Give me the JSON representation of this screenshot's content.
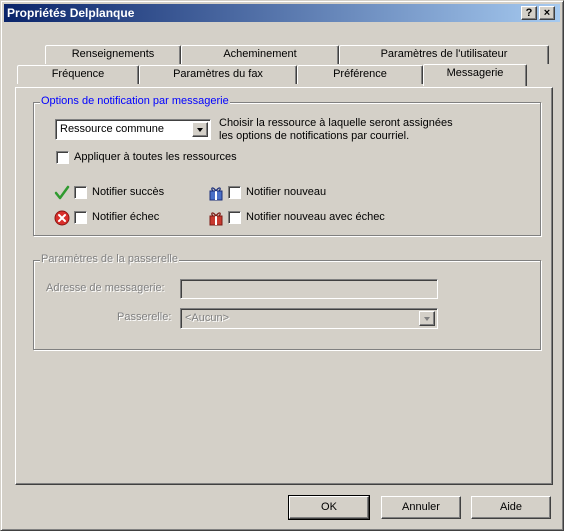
{
  "window": {
    "title": "Propriétés Delplanque",
    "help_btn": "?",
    "close_btn": "×"
  },
  "tabs_row1": [
    "Renseignements",
    "Acheminement",
    "Paramètres de l'utilisateur"
  ],
  "tabs_row2": [
    "Fréquence",
    "Paramètres du fax",
    "Préférence",
    "Messagerie"
  ],
  "active_tab": "Messagerie",
  "notifications": {
    "group_label": "Options de notification par messagerie",
    "resource_select": "Ressource commune",
    "resource_help_line1": "Choisir la ressource à laquelle seront assignées",
    "resource_help_line2": "les options de notifications par courriel.",
    "apply_all_label": "Appliquer à toutes les ressources",
    "apply_all_checked": false,
    "success_label": "Notifier succès",
    "new_label": "Notifier nouveau",
    "failure_label": "Notifier échec",
    "new_failure_label": "Notifier nouveau avec échec"
  },
  "gateway": {
    "group_label": "Paramètres de la passerelle",
    "address_label": "Adresse de messagerie:",
    "address_value": "",
    "gateway_label": "Passerelle:",
    "gateway_value": "<Aucun>"
  },
  "buttons": {
    "ok": "OK",
    "cancel": "Annuler",
    "help": "Aide"
  },
  "colors": {
    "accent": "#0a246a",
    "group_label_blue": "#0000ff",
    "face": "#d4d0c8"
  }
}
